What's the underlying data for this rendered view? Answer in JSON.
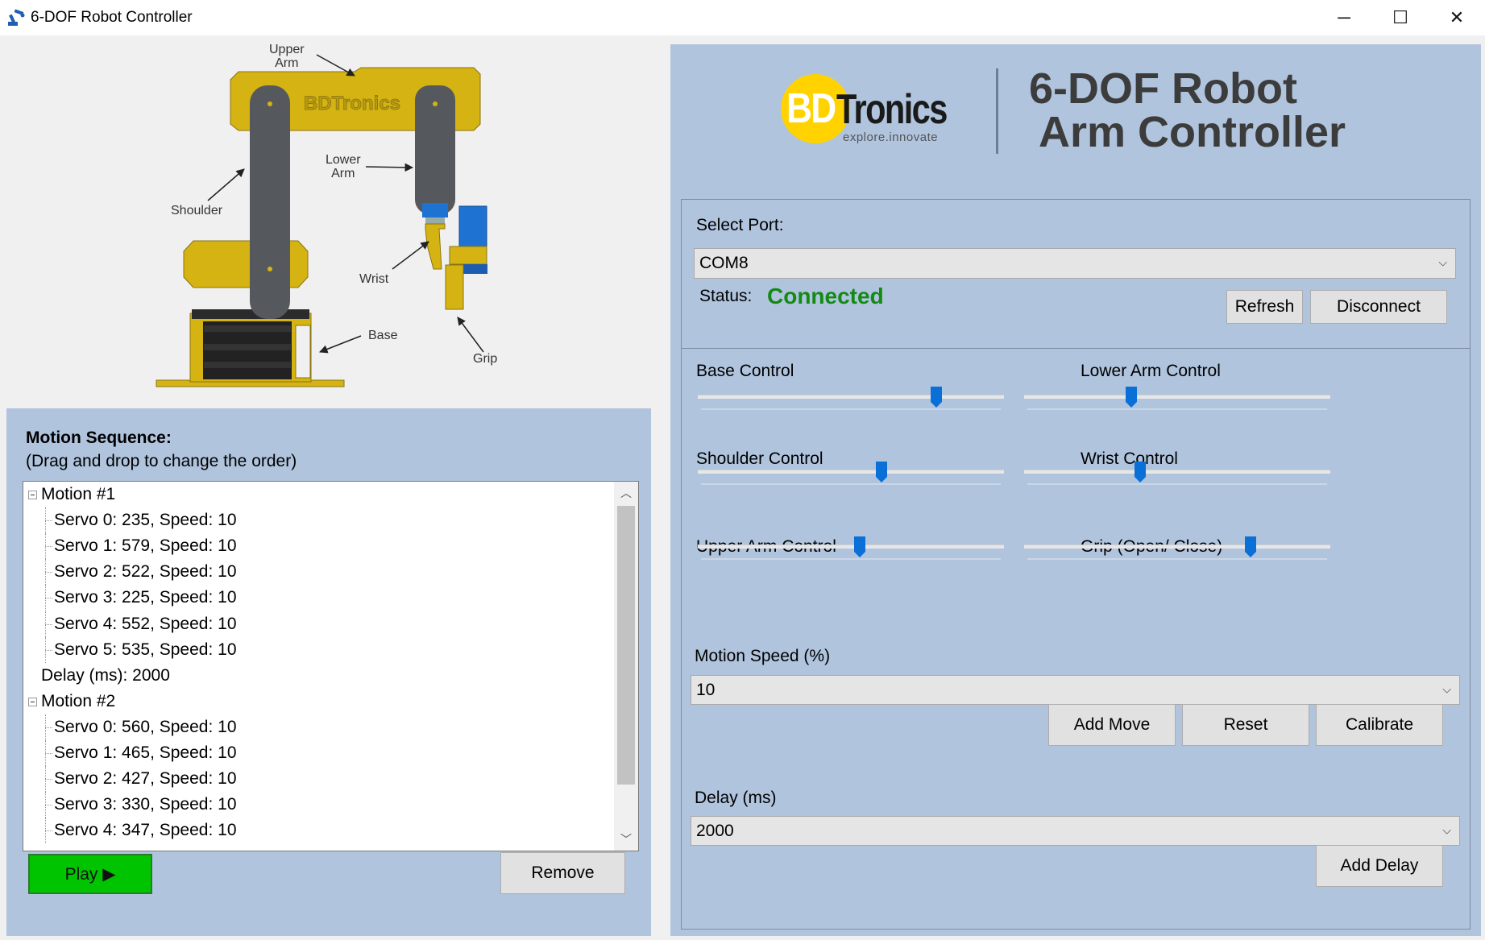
{
  "window": {
    "title": "6-DOF Robot Controller",
    "controls": {
      "minimize": "─",
      "maximize": "☐",
      "close": "✕"
    }
  },
  "diagram": {
    "labels": {
      "upper_arm": "Upper\nArm",
      "lower_arm": "Lower\nArm",
      "shoulder": "Shoulder",
      "wrist": "Wrist",
      "base": "Base",
      "grip": "Grip"
    },
    "brand_mark": "BDTronics",
    "colors": {
      "yellow": "#d4b312",
      "dark": "#55595e",
      "black": "#222222",
      "blue": "#1e73d2"
    }
  },
  "motion": {
    "title": "Motion Sequence:",
    "subtitle": "(Drag and drop to change the order)",
    "tree": [
      {
        "label": "Motion #1",
        "level": 0,
        "expander": true
      },
      {
        "label": "Servo 0: 235, Speed: 10",
        "level": 1
      },
      {
        "label": "Servo 1: 579, Speed: 10",
        "level": 1
      },
      {
        "label": "Servo 2: 522, Speed: 10",
        "level": 1
      },
      {
        "label": "Servo 3: 225, Speed: 10",
        "level": 1
      },
      {
        "label": "Servo 4: 552, Speed: 10",
        "level": 1
      },
      {
        "label": "Servo 5: 535, Speed: 10",
        "level": 1
      },
      {
        "label": "Delay (ms): 2000",
        "level": 0
      },
      {
        "label": "Motion #2",
        "level": 0,
        "expander": true
      },
      {
        "label": "Servo 0: 560, Speed: 10",
        "level": 1
      },
      {
        "label": "Servo 1: 465, Speed: 10",
        "level": 1
      },
      {
        "label": "Servo 2: 427, Speed: 10",
        "level": 1
      },
      {
        "label": "Servo 3: 330, Speed: 10",
        "level": 1
      },
      {
        "label": "Servo 4: 347, Speed: 10",
        "level": 1
      }
    ],
    "play_label": "Play ▶",
    "remove_label": "Remove",
    "play_color": "#00c400"
  },
  "header": {
    "logo_bd": "BD",
    "logo_tronics": "Tronics",
    "logo_tagline": "explore.innovate",
    "logo_circle_color": "#ffd200",
    "title_line1": "6-DOF Robot",
    "title_line2": "Arm Controller"
  },
  "connection": {
    "port_label": "Select Port:",
    "port_value": "COM8",
    "status_label": "Status:",
    "status_value": "Connected",
    "status_color": "#148a14",
    "refresh_label": "Refresh",
    "disconnect_label": "Disconnect"
  },
  "controls": {
    "sliders": [
      {
        "label": "Base Control",
        "value": 0.78
      },
      {
        "label": "Lower Arm Control",
        "value": 0.35
      },
      {
        "label": "Shoulder Control",
        "value": 0.6
      },
      {
        "label": "Wrist Control",
        "value": 0.38
      },
      {
        "label": "Upper Arm Control",
        "value": 0.53
      },
      {
        "label": "Grip (Open/ Close)",
        "value": 0.74
      }
    ],
    "slider_accent": "#0a6fd6",
    "speed_label": "Motion Speed (%)",
    "speed_value": "10",
    "add_move_label": "Add Move",
    "reset_label": "Reset",
    "calibrate_label": "Calibrate",
    "delay_label": "Delay (ms)",
    "delay_value": "2000",
    "add_delay_label": "Add Delay"
  }
}
